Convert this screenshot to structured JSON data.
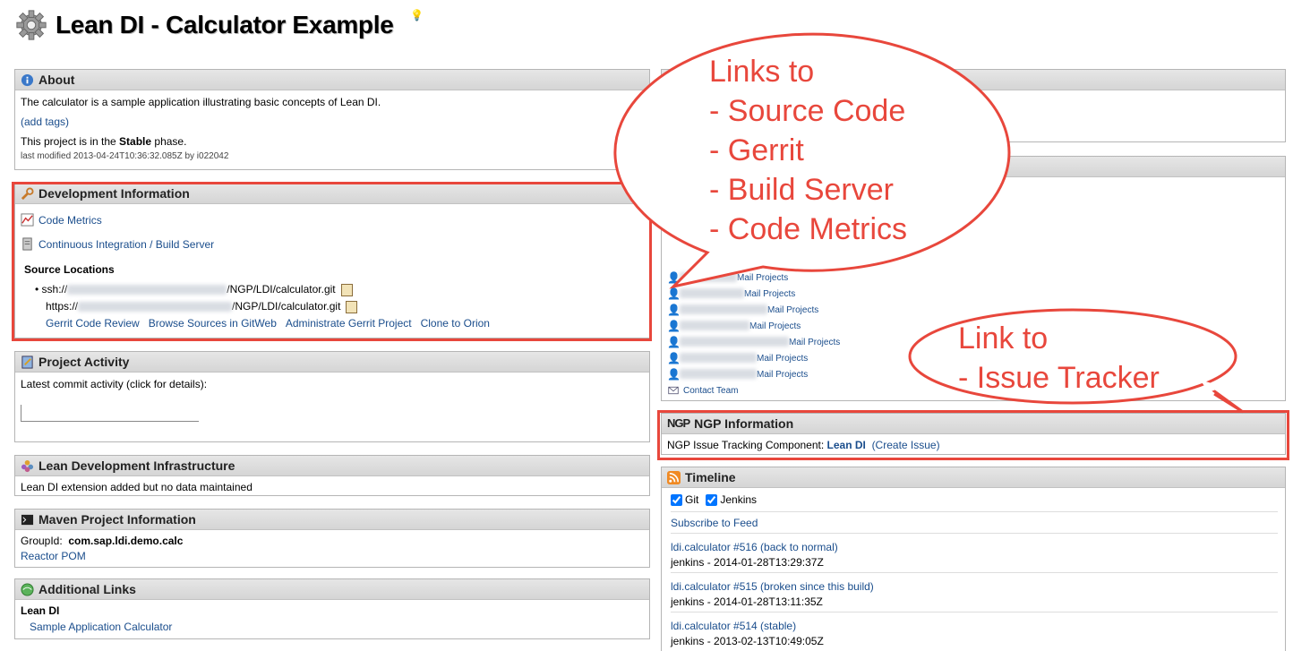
{
  "page": {
    "title": "Lean DI - Calculator Example"
  },
  "about": {
    "heading": "About",
    "description": "The calculator is a sample application illustrating basic concepts of Lean DI.",
    "add_tags": "(add tags)",
    "phase_prefix": "This project is in the ",
    "phase": "Stable",
    "phase_suffix": " phase.",
    "last_modified": "last modified 2013-04-24T10:36:32.085Z by i022042"
  },
  "dev_info": {
    "heading": "Development Information",
    "code_metrics": "Code Metrics",
    "ci_build": "Continuous Integration / Build Server",
    "source_locations": "Source Locations",
    "ssh_prefix": "ssh://",
    "ssh_suffix": "/NGP/LDI/calculator.git",
    "https_prefix": "https://",
    "https_suffix": "/NGP/LDI/calculator.git",
    "links": [
      "Gerrit Code Review",
      "Browse Sources in GitWeb",
      "Administrate Gerrit Project",
      "Clone to Orion"
    ]
  },
  "project_activity": {
    "heading": "Project Activity",
    "text": "Latest commit activity (click for details):"
  },
  "lean_infra": {
    "heading": "Lean Development Infrastructure",
    "text": "Lean DI extension added but no data maintained"
  },
  "maven": {
    "heading": "Maven Project Information",
    "group_label": "GroupId:",
    "group_value": "com.sap.ldi.demo.calc",
    "reactor": "Reactor POM"
  },
  "additional_links": {
    "heading": "Additional Links",
    "group": "Lean DI",
    "link": "Sample Application Calculator"
  },
  "team": {
    "proj_label": "Proj",
    "mail_projects": "Mail Projects",
    "contact": "Contact Team"
  },
  "ngp": {
    "heading": "NGP Information",
    "label": "NGP Issue Tracking Component:",
    "component": "Lean DI",
    "create_issue": "(Create Issue)"
  },
  "timeline": {
    "heading": "Timeline",
    "filters": [
      "Git",
      "Jenkins"
    ],
    "subscribe": "Subscribe to Feed",
    "items": [
      {
        "title": "ldi.calculator #516 (back to normal)",
        "meta": "jenkins - 2014-01-28T13:29:37Z"
      },
      {
        "title": "ldi.calculator #515 (broken since this build)",
        "meta": "jenkins - 2014-01-28T13:11:35Z"
      },
      {
        "title": "ldi.calculator #514 (stable)",
        "meta": "jenkins - 2013-02-13T10:49:05Z"
      }
    ]
  },
  "callouts": {
    "big": "Links to\n- Source Code\n- Gerrit\n- Build Server\n- Code Metrics",
    "small": "Link to\n- Issue Tracker"
  },
  "colors": {
    "accent_red": "#e8473c",
    "link": "#1a4d8c",
    "header_bg": "#dcdcdc"
  }
}
